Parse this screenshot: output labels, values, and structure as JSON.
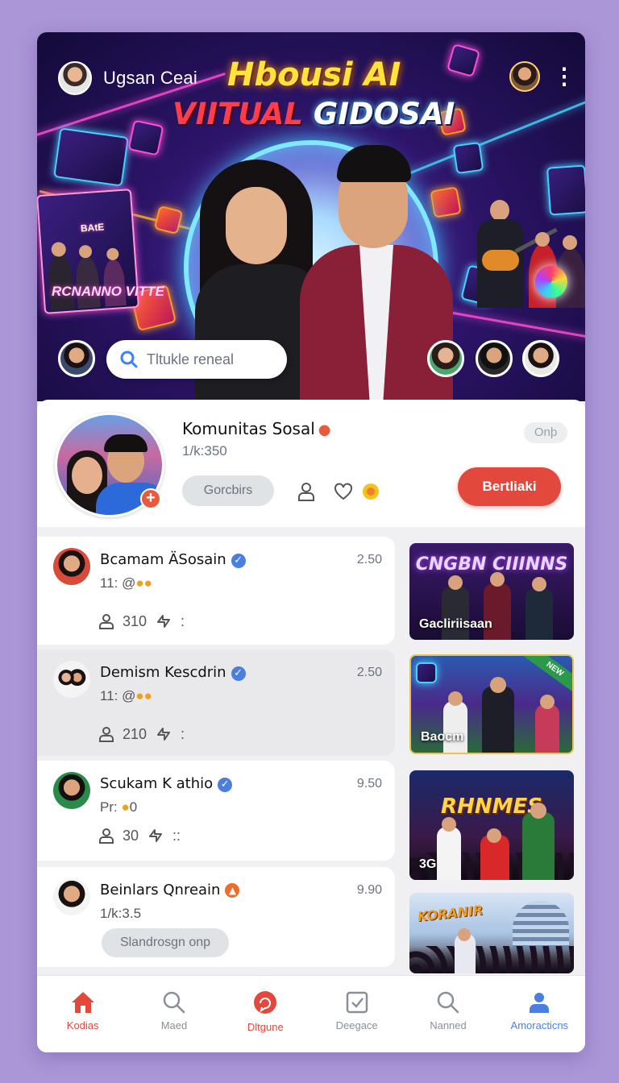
{
  "hero": {
    "user_name": "Ugsan Ceai",
    "title_line1": "Hbousi AI",
    "title_line2_a": "VIITUAL",
    "title_line2_b": "GIDOSAI",
    "panel_text": "RCNANNO VITTE",
    "panel_sign": "BAtE",
    "search_placeholder": "Tltukle reneal"
  },
  "community": {
    "name": "Komunitas Sosal",
    "members": "1/k:350",
    "online_label": "Onþ",
    "secondary_button": "Gorcbirs",
    "primary_button": "Bertliaki"
  },
  "posts": [
    {
      "name": "Bcamam ÄSosain",
      "time": "2.50",
      "sub": "11: @",
      "likes": "310"
    },
    {
      "name": "Demism Kescdrin",
      "time": "2.50",
      "sub": "11: @",
      "likes": "210"
    },
    {
      "name": "Scukam K athio",
      "time": "9.50",
      "sub": "Pr: ",
      "sub_num": "0",
      "likes": "30"
    },
    {
      "name": "Beinlars Qnreain",
      "time": "9.90",
      "sub": "1/k:3.5",
      "tag": "Slandrosgn onp"
    }
  ],
  "thumbnails": [
    {
      "title": "CNGBN CIIINNS",
      "label": "Gacliriisaan"
    },
    {
      "title": "",
      "label": "Baocm",
      "ribbon": "NEW"
    },
    {
      "title": "RHNMES",
      "label": "3G"
    },
    {
      "title": "KORANIR",
      "label": ""
    }
  ],
  "nav": [
    {
      "label": "Kodias",
      "icon": "home-icon"
    },
    {
      "label": "Maed",
      "icon": "search-icon"
    },
    {
      "label": "Dltgune",
      "icon": "chat-bubble-icon"
    },
    {
      "label": "Deegace",
      "icon": "checkbox-icon"
    },
    {
      "label": "Nanned",
      "icon": "search-icon"
    },
    {
      "label": "Amoracticns",
      "icon": "profile-icon"
    }
  ],
  "colors": {
    "accent": "#e2493c",
    "verified": "#4a7fe0",
    "background": "#ab96d8"
  }
}
